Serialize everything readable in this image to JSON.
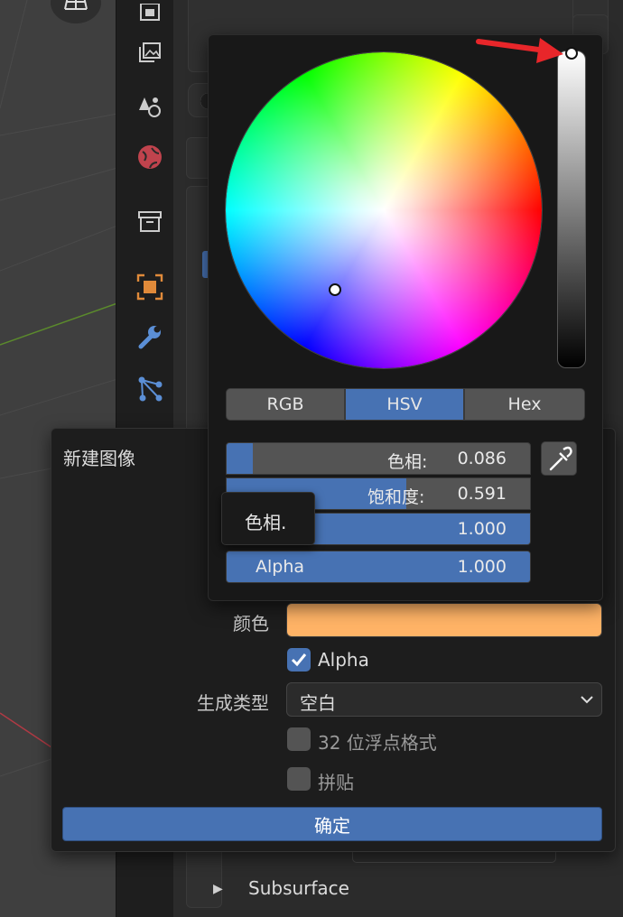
{
  "picker": {
    "modes": [
      {
        "label": "RGB",
        "active": false
      },
      {
        "label": "HSV",
        "active": true
      },
      {
        "label": "Hex",
        "active": false
      }
    ],
    "hue": {
      "label": "色相:",
      "value": "0.086",
      "level": 0.086
    },
    "saturation": {
      "label": "饱和度:",
      "value": "0.591",
      "level": 0.591
    },
    "value": {
      "label": "",
      "value": "1.000",
      "level": 1.0
    },
    "alpha": {
      "label": "Alpha",
      "value": "1.000",
      "level": 1.0
    },
    "value_bar_level": 1.0
  },
  "tooltip": {
    "text": "色相."
  },
  "dialog": {
    "title": "新建图像",
    "color_label": "颜色",
    "color_swatch": "#ffb366",
    "alpha_checkbox": {
      "label": "Alpha",
      "checked": true
    },
    "generated_type": {
      "label": "生成类型",
      "value": "空白"
    },
    "float_checkbox": {
      "label": "32 位浮点格式",
      "checked": false
    },
    "tiled_checkbox": {
      "label": "拼贴",
      "checked": false
    },
    "confirm_label": "确定"
  },
  "properties": {
    "subsurface_label": "Subsurface"
  },
  "colors": {
    "accent": "#4772b3",
    "annotation_arrow": "#e8262a"
  }
}
